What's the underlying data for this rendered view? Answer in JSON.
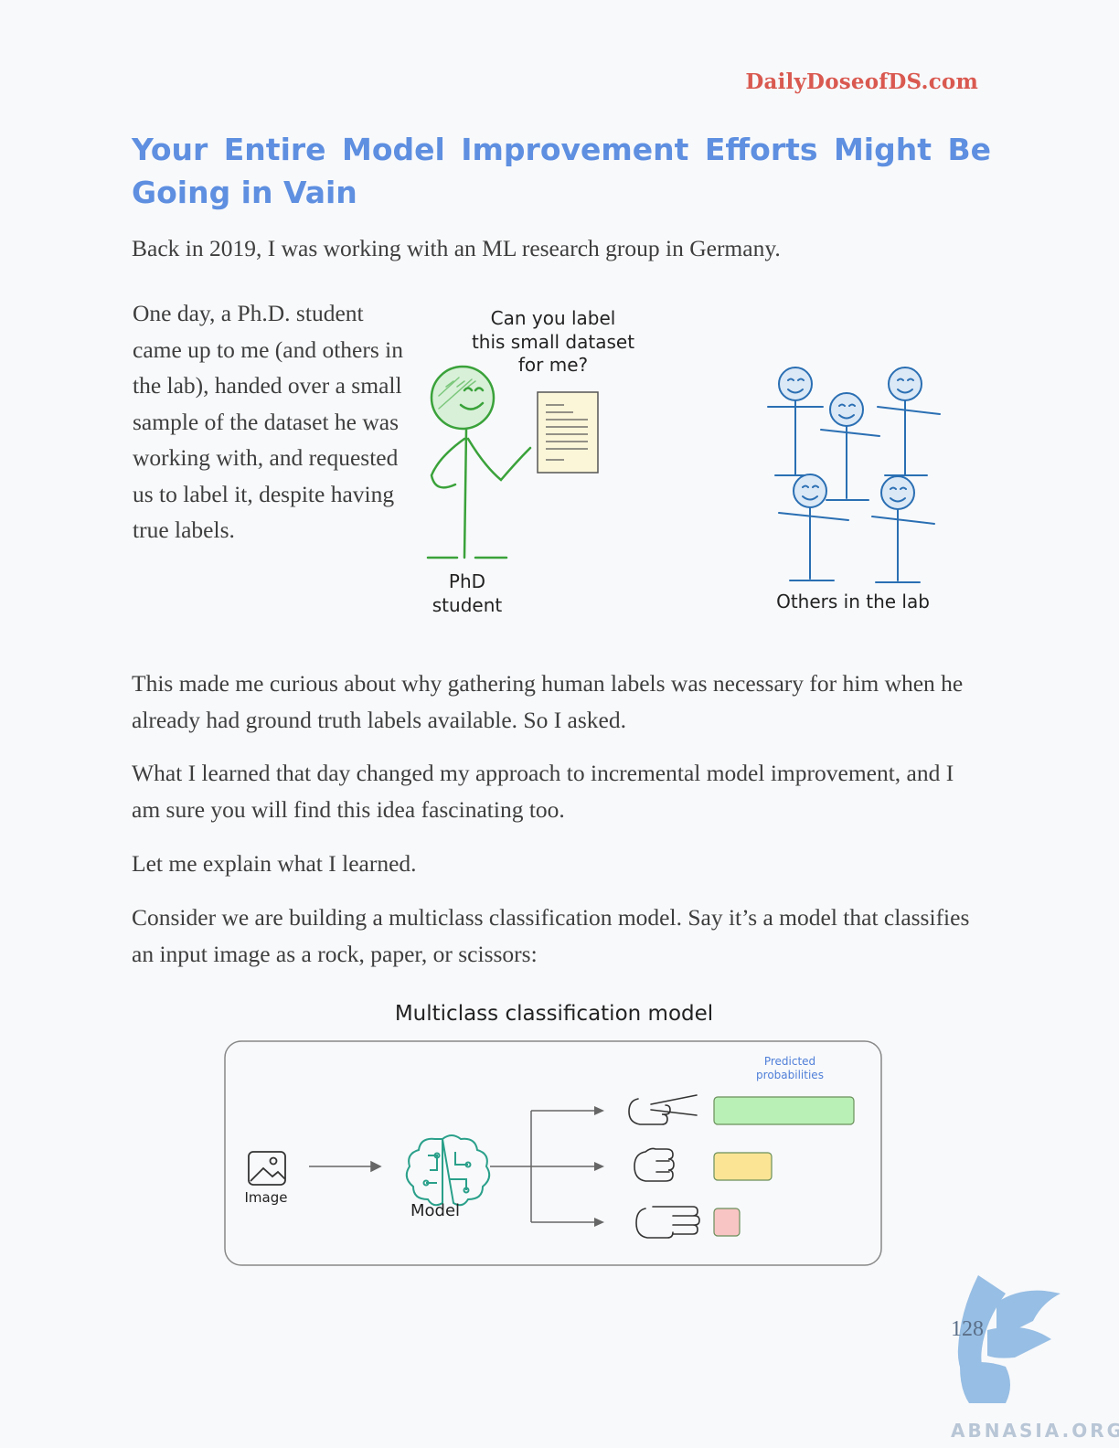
{
  "header": {
    "site": "DailyDoseofDS.com"
  },
  "title": "Your Entire Model Improvement Efforts Might Be Going in Vain",
  "paragraphs": {
    "p1": "Back in 2019, I was working with an ML research group in Germany.",
    "p2": "One day, a Ph.D. student came up to me (and others in the lab), handed over a small sample of the dataset he was working with, and requested us to label it, despite having true labels.",
    "p3": "This made me curious about why gathering human labels was necessary for him when he already had ground truth labels available. So I asked.",
    "p4": "What I learned that day changed my approach to incremental model improvement, and I am sure you will find this idea fascinating too.",
    "p5": "Let me explain what I learned.",
    "p6": "Consider we are building a multiclass classification model. Say it’s a model that classifies an input image as a rock, paper, or scissors:"
  },
  "figure1": {
    "speech_line1": "Can you label",
    "speech_line2": "this small dataset",
    "speech_line3": "for me?",
    "student_line1": "PhD",
    "student_line2": "student",
    "others_label": "Others in the lab",
    "student_color": "#3aa23a",
    "others_color": "#2a6fb3"
  },
  "figure2": {
    "title": "Multiclass classification model",
    "image_label": "Image",
    "model_label": "Model",
    "pred_line1": "Predicted",
    "pred_line2": "probabilities",
    "probabilities": [
      {
        "class_icon": "scissors-hand-icon",
        "value": 0.85,
        "color": "#b9f0b5"
      },
      {
        "class_icon": "rock-fist-icon",
        "value": 0.35,
        "color": "#fbe595"
      },
      {
        "class_icon": "paper-hand-icon",
        "value": 0.15,
        "color": "#f9c4c4"
      }
    ]
  },
  "footer": {
    "page_number": "128",
    "watermark": "ABNASIA.ORG"
  }
}
